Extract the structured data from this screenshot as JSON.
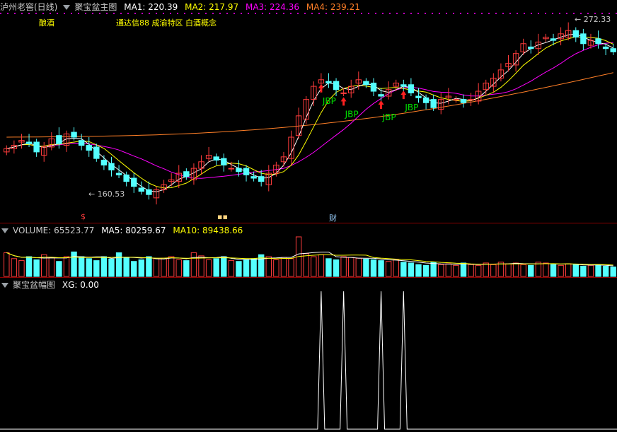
{
  "main": {
    "title": "泸州老窖(日线)",
    "indicator": "聚宝盆主图",
    "ma": [
      {
        "label": "MA1: 220.39",
        "color": "#ffffff"
      },
      {
        "label": "MA2: 217.97",
        "color": "#ffff00"
      },
      {
        "label": "MA3: 224.36",
        "color": "#ff00ff"
      },
      {
        "label": "MA4: 239.21",
        "color": "#ff7f27"
      }
    ],
    "tags": [
      "酿酒",
      "通达信88 成渝特区 白酒概念"
    ],
    "high_label": "272.33",
    "low_label": "160.53",
    "jbp_label": "JBP",
    "markers": [
      "$",
      "财"
    ]
  },
  "volume": {
    "title": "VOLUME: 65523.77",
    "ma5": "MA5: 80259.67",
    "ma10": "MA10: 89438.66"
  },
  "sub": {
    "title": "聚宝盆幅图",
    "xg": "XG: 0.00"
  },
  "colors": {
    "up": "#ff3c3c",
    "down": "#54ffff",
    "ma1": "#ffffff",
    "ma2": "#ffff00",
    "ma3": "#ff00ff",
    "ma4": "#ff7f27",
    "jbp": "#00e000",
    "arrow": "#ff2020"
  },
  "chart_data": {
    "type": "candlestick",
    "y_high": 272.33,
    "y_low": 160.53,
    "close_path": [
      198,
      200,
      203,
      201,
      196,
      199,
      204,
      201,
      207,
      205,
      200,
      197,
      192,
      188,
      185,
      182,
      178,
      175,
      172,
      170,
      173,
      176,
      179,
      183,
      181,
      186,
      190,
      194,
      191,
      188,
      186,
      184,
      182,
      180,
      178,
      183,
      188,
      193,
      205,
      218,
      228,
      236,
      240,
      238,
      234,
      232,
      236,
      240,
      237,
      233,
      230,
      234,
      238,
      236,
      232,
      229,
      226,
      223,
      228,
      230,
      228,
      226,
      228,
      233,
      238,
      241,
      246,
      250,
      256,
      262,
      259,
      263,
      266,
      264,
      268,
      270,
      266,
      262,
      264,
      262,
      259,
      257
    ],
    "jbp_signal_index": [
      42,
      45,
      50,
      53
    ],
    "volume_level": [
      0.6,
      0.45,
      0.4,
      0.5,
      0.42,
      0.55,
      0.48,
      0.38,
      0.5,
      0.62,
      0.5,
      0.45,
      0.4,
      0.5,
      0.44,
      0.6,
      0.48,
      0.38,
      0.42,
      0.5,
      0.45,
      0.46,
      0.5,
      0.42,
      0.4,
      0.6,
      0.52,
      0.42,
      0.45,
      0.5,
      0.4,
      0.38,
      0.42,
      0.45,
      0.55,
      0.5,
      0.42,
      0.48,
      0.45,
      1.0,
      0.58,
      0.5,
      0.55,
      0.45,
      0.42,
      0.5,
      0.48,
      0.46,
      0.44,
      0.42,
      0.4,
      0.38,
      0.42,
      0.36,
      0.34,
      0.3,
      0.28,
      0.36,
      0.3,
      0.32,
      0.28,
      0.34,
      0.3,
      0.28,
      0.34,
      0.3,
      0.36,
      0.32,
      0.34,
      0.3,
      0.28,
      0.36,
      0.34,
      0.3,
      0.28,
      0.32,
      0.3,
      0.26,
      0.28,
      0.3,
      0.26,
      0.24
    ]
  }
}
